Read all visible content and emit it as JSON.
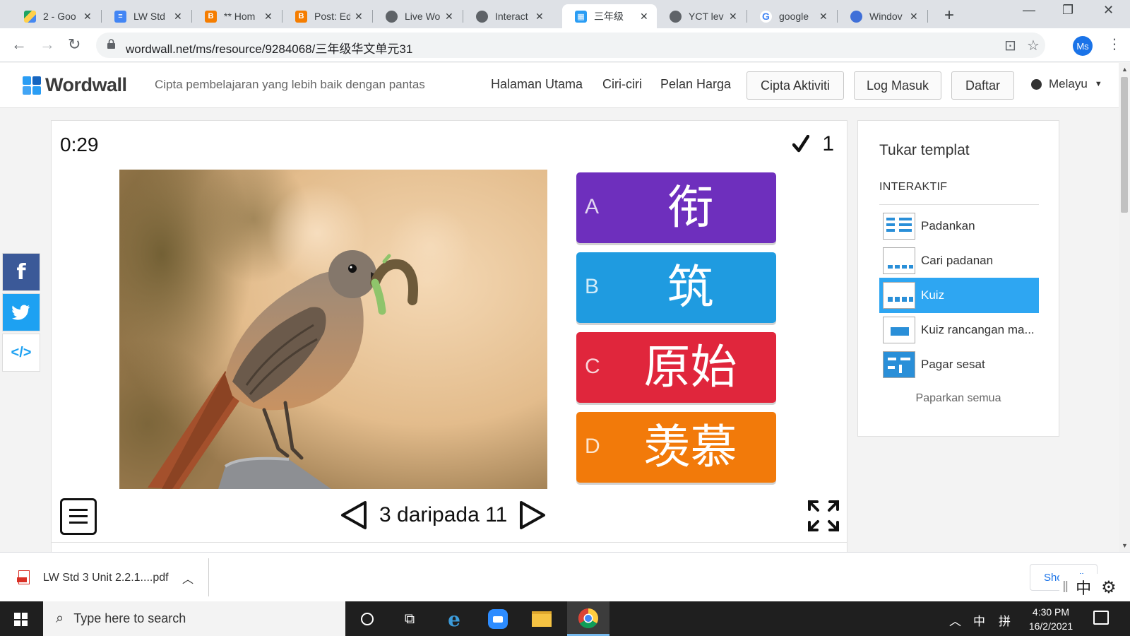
{
  "browser": {
    "tabs": [
      {
        "label": "2 - Goo",
        "icon": "google-drive-icon"
      },
      {
        "label": "LW Std",
        "icon": "google-docs-icon"
      },
      {
        "label": "** Hom",
        "icon": "blogger-icon"
      },
      {
        "label": "Post: Ed",
        "icon": "blogger-icon"
      },
      {
        "label": "Live Wo",
        "icon": "globe-icon"
      },
      {
        "label": "Interact",
        "icon": "globe-icon"
      },
      {
        "label": "三年级",
        "icon": "wordwall-icon"
      },
      {
        "label": "YCT lev",
        "icon": "globe-icon"
      },
      {
        "label": "google",
        "icon": "google-icon"
      },
      {
        "label": "Windov",
        "icon": "windows-icon"
      }
    ],
    "active_tab": 6,
    "url": "wordwall.net/ms/resource/9284068/三年级华文单元31",
    "profile_initials": "Ms"
  },
  "site": {
    "logo_text": "Wordwall",
    "tagline": "Cipta pembelajaran yang lebih baik dengan pantas",
    "nav": [
      "Halaman Utama",
      "Ciri-ciri",
      "Pelan Harga"
    ],
    "buttons": [
      "Cipta Aktiviti",
      "Log Masuk",
      "Daftar"
    ],
    "language": "Melayu"
  },
  "quiz": {
    "timer": "0:29",
    "score": "1",
    "image_subject": "bird-with-caterpillar",
    "answers": [
      {
        "letter": "A",
        "text": "衔",
        "color": "#6e2fbd"
      },
      {
        "letter": "B",
        "text": "筑",
        "color": "#1f9be0"
      },
      {
        "letter": "C",
        "text": "原始",
        "color": "#e0263c"
      },
      {
        "letter": "D",
        "text": "羡慕",
        "color": "#f27a0a"
      }
    ],
    "pager_text": "3 daripada 11"
  },
  "templates": {
    "title": "Tukar templat",
    "section": "INTERAKTIF",
    "items": [
      "Padankan",
      "Cari padanan",
      "Kuiz",
      "Kuiz rancangan ma...",
      "Pagar sesat"
    ],
    "selected": 2,
    "more": "Paparkan semua"
  },
  "download": {
    "filename": "LW Std 3 Unit 2.2.1....pdf",
    "show_all": "Show all"
  },
  "taskbar": {
    "search_placeholder": "Type here to search",
    "ime_char": "中",
    "ime_char2": "拼",
    "time": "4:30 PM",
    "date": "16/2/2021"
  },
  "colors": {
    "accent": "#2ea6f2",
    "facebook": "#3b5998",
    "twitter": "#1da1f2"
  }
}
